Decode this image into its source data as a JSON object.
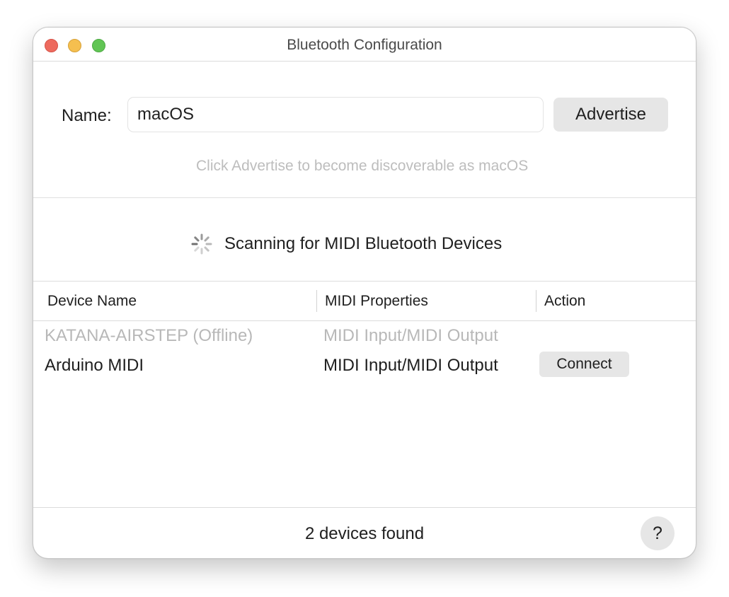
{
  "window": {
    "title": "Bluetooth Configuration"
  },
  "advertise": {
    "name_label": "Name:",
    "name_value": "macOS",
    "button_label": "Advertise",
    "hint": "Click Advertise to become discoverable as macOS"
  },
  "scanning": {
    "icon": "spinner-icon",
    "text": "Scanning for MIDI Bluetooth Devices"
  },
  "table": {
    "columns": [
      "Device Name",
      "MIDI Properties",
      "Action"
    ],
    "rows": [
      {
        "device_name": "KATANA-AIRSTEP (Offline)",
        "midi_properties": "MIDI Input/MIDI Output",
        "action": ""
      },
      {
        "device_name": "Arduino MIDI",
        "midi_properties": "MIDI Input/MIDI Output",
        "action": "Connect"
      }
    ]
  },
  "footer": {
    "status": "2 devices found",
    "help_label": "?"
  },
  "colors": {
    "close": "#ed6a5e",
    "minimize": "#f5bf4f",
    "maximize": "#61c554",
    "button_bg": "#e6e6e6",
    "disabled_text": "#b8b8b8"
  }
}
